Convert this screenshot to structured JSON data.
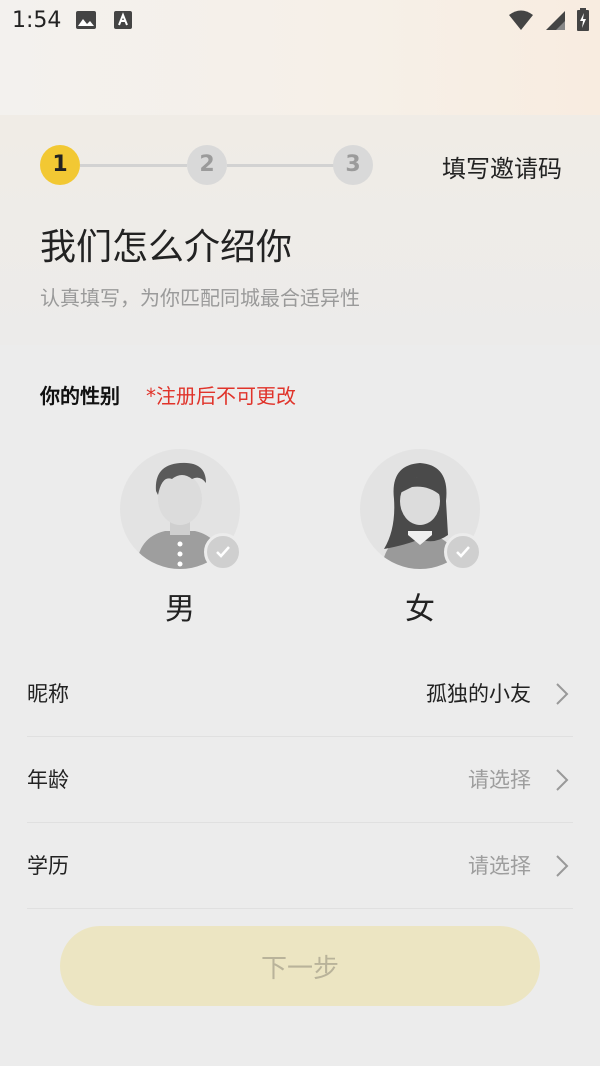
{
  "status_bar": {
    "time": "1:54",
    "icons": [
      "image-icon",
      "text-a-icon",
      "wifi-icon",
      "signal-icon",
      "battery-charging-icon"
    ]
  },
  "steps": [
    {
      "number": "1",
      "state": "active"
    },
    {
      "number": "2",
      "state": "inactive"
    },
    {
      "number": "3",
      "state": "inactive"
    }
  ],
  "invite_link": "填写邀请码",
  "title": "我们怎么介绍你",
  "subtitle": "认真填写，为你匹配同城最合适异性",
  "gender": {
    "label": "你的性别",
    "warning": "*注册后不可更改",
    "options": [
      {
        "label": "男",
        "icon": "male-avatar-icon"
      },
      {
        "label": "女",
        "icon": "female-avatar-icon"
      }
    ]
  },
  "form": {
    "rows": [
      {
        "label": "昵称",
        "value": "孤独的小友",
        "filled": true
      },
      {
        "label": "年龄",
        "value": "请选择",
        "filled": false
      },
      {
        "label": "学历",
        "value": "请选择",
        "filled": false
      }
    ]
  },
  "next_button": "下一步",
  "colors": {
    "accent": "#f2c833",
    "warning": "#e0332a",
    "button_bg": "#ece5c2"
  }
}
